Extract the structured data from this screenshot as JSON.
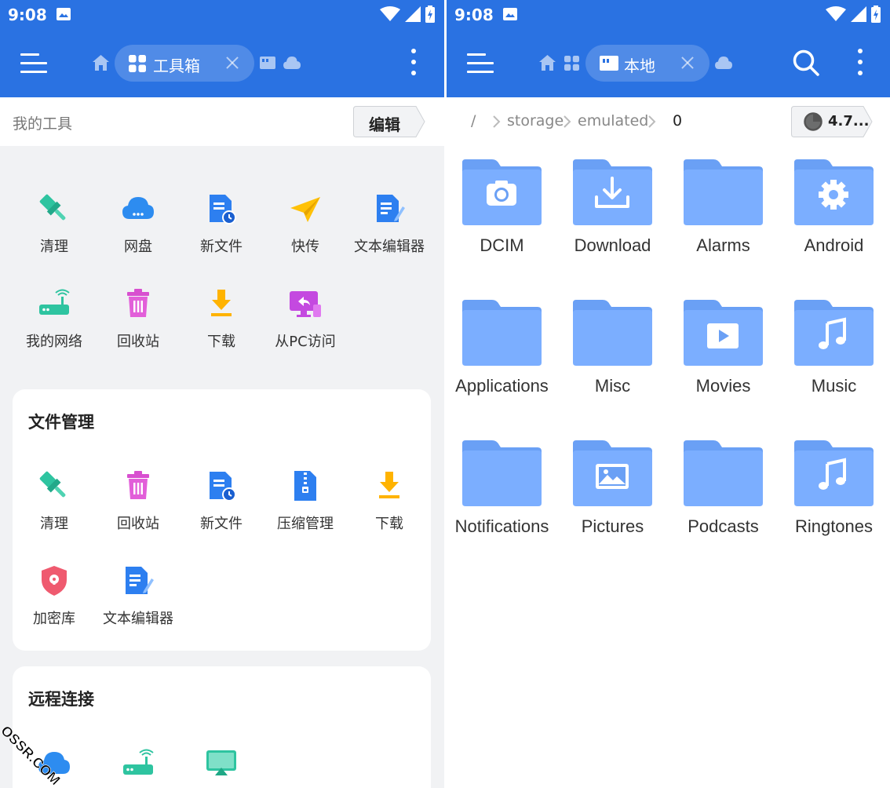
{
  "status_bar": {
    "time": "9:08"
  },
  "left_panel": {
    "tab": {
      "label": "工具箱",
      "icon": "grid-icon"
    },
    "my_tools": {
      "title": "我的工具",
      "edit_label": "编辑",
      "items": [
        {
          "label": "清理",
          "icon": "broom-icon"
        },
        {
          "label": "网盘",
          "icon": "cloud-drive-icon"
        },
        {
          "label": "新文件",
          "icon": "new-file-icon"
        },
        {
          "label": "快传",
          "icon": "paper-plane-icon"
        },
        {
          "label": "文本编辑器",
          "icon": "text-editor-icon"
        },
        {
          "label": "我的网络",
          "icon": "router-icon"
        },
        {
          "label": "回收站",
          "icon": "trash-icon"
        },
        {
          "label": "下载",
          "icon": "download-icon"
        },
        {
          "label": "从PC访问",
          "icon": "pc-access-icon"
        }
      ]
    },
    "file_management": {
      "title": "文件管理",
      "items": [
        {
          "label": "清理",
          "icon": "broom-icon"
        },
        {
          "label": "回收站",
          "icon": "trash-icon"
        },
        {
          "label": "新文件",
          "icon": "new-file-icon"
        },
        {
          "label": "压缩管理",
          "icon": "zip-icon"
        },
        {
          "label": "下载",
          "icon": "download-icon"
        },
        {
          "label": "加密库",
          "icon": "vault-shield-icon"
        },
        {
          "label": "文本编辑器",
          "icon": "text-editor-icon"
        }
      ]
    },
    "remote": {
      "title": "远程连接",
      "items": [
        {
          "icon": "cloud-drive-icon"
        },
        {
          "icon": "router-icon"
        },
        {
          "icon": "cast-screen-icon"
        }
      ]
    },
    "watermark": "OSSR.COM"
  },
  "right_panel": {
    "tab": {
      "label": "本地",
      "icon": "sd-card-icon"
    },
    "breadcrumb": {
      "root": "/",
      "parts": [
        "storage",
        "emulated",
        "0"
      ]
    },
    "storage_usage": "4.7...",
    "folders": [
      {
        "name": "DCIM",
        "icon": "camera-icon"
      },
      {
        "name": "Download",
        "icon": "download-tray-icon"
      },
      {
        "name": "Alarms",
        "icon": ""
      },
      {
        "name": "Android",
        "icon": "gear-icon"
      },
      {
        "name": "Applications",
        "icon": ""
      },
      {
        "name": "Misc",
        "icon": ""
      },
      {
        "name": "Movies",
        "icon": "play-icon"
      },
      {
        "name": "Music",
        "icon": "music-note-icon"
      },
      {
        "name": "Notifications",
        "icon": ""
      },
      {
        "name": "Pictures",
        "icon": "picture-icon"
      },
      {
        "name": "Podcasts",
        "icon": ""
      },
      {
        "name": "Ringtones",
        "icon": "music-note-icon"
      }
    ]
  },
  "colors": {
    "appbar": "#2a72e2",
    "folder": "#7baeff",
    "folder_tab": "#6aa0f5"
  }
}
